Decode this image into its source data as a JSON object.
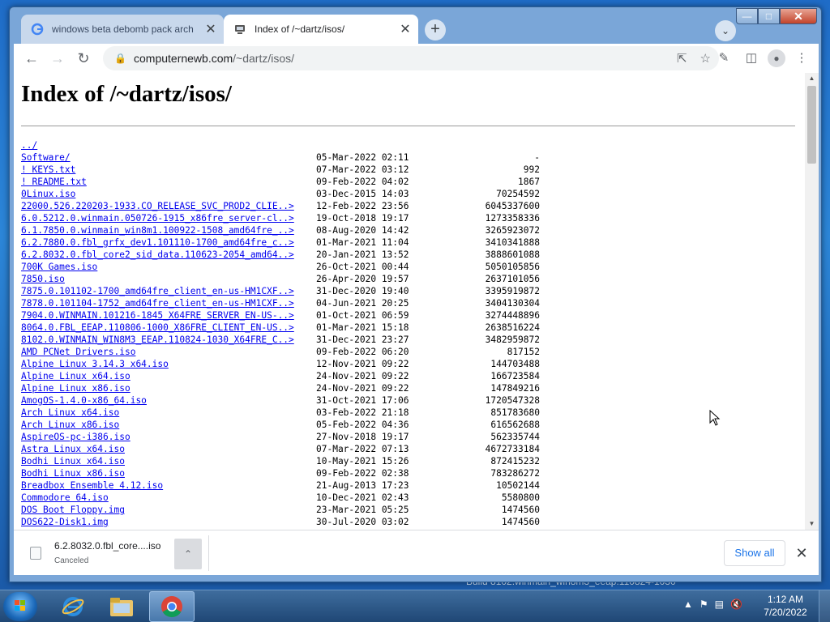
{
  "browser": {
    "tabs": [
      {
        "title": "windows beta debomb pack arch",
        "active": false
      },
      {
        "title": "Index of /~dartz/isos/",
        "active": true
      }
    ],
    "url_host": "computernewb.com",
    "url_path": "/~dartz/isos/"
  },
  "page": {
    "title": "Index of /~dartz/isos/",
    "entries": [
      {
        "name": "../",
        "date": "",
        "size": ""
      },
      {
        "name": "Software/",
        "date": "05-Mar-2022 02:11",
        "size": "-"
      },
      {
        "name": "! KEYS.txt",
        "date": "07-Mar-2022 03:12",
        "size": "992"
      },
      {
        "name": "! README.txt",
        "date": "09-Feb-2022 04:02",
        "size": "1867"
      },
      {
        "name": "0Linux.iso",
        "date": "03-Dec-2015 14:03",
        "size": "70254592"
      },
      {
        "name": "22000.526.220203-1933.CO_RELEASE_SVC_PROD2_CLIE..>",
        "date": "12-Feb-2022 23:56",
        "size": "6045337600"
      },
      {
        "name": "6.0.5212.0.winmain.050726-1915_x86fre_server-cl..>",
        "date": "19-Oct-2018 19:17",
        "size": "1273358336"
      },
      {
        "name": "6.1.7850.0.winmain_win8m1.100922-1508_amd64fre_..>",
        "date": "08-Aug-2020 14:42",
        "size": "3265923072"
      },
      {
        "name": "6.2.7880.0.fbl_grfx_dev1.101110-1700_amd64fre_c..>",
        "date": "01-Mar-2021 11:04",
        "size": "3410341888"
      },
      {
        "name": "6.2.8032.0.fbl_core2_sid_data.110623-2054_amd64..>",
        "date": "20-Jan-2021 13:52",
        "size": "3888601088"
      },
      {
        "name": "700K Games.iso",
        "date": "26-Oct-2021 00:44",
        "size": "5050105856"
      },
      {
        "name": "7850.iso",
        "date": "26-Apr-2020 19:57",
        "size": "2637101056"
      },
      {
        "name": "7875.0.101102-1700_amd64fre_client_en-us-HM1CXF..>",
        "date": "31-Dec-2020 19:40",
        "size": "3395919872"
      },
      {
        "name": "7878.0.101104-1752_amd64fre_client_en-us-HM1CXF..>",
        "date": "04-Jun-2021 20:25",
        "size": "3404130304"
      },
      {
        "name": "7904.0.WINMAIN.101216-1845_X64FRE_SERVER_EN-US-..>",
        "date": "01-Oct-2021 06:59",
        "size": "3274448896"
      },
      {
        "name": "8064.0.FBL_EEAP.110806-1000_X86FRE_CLIENT_EN-US..>",
        "date": "01-Mar-2021 15:18",
        "size": "2638516224"
      },
      {
        "name": "8102.0.WINMAIN_WIN8M3_EEAP.110824-1030_X64FRE_C..>",
        "date": "31-Dec-2021 23:27",
        "size": "3482959872"
      },
      {
        "name": "AMD PCNet Drivers.iso",
        "date": "09-Feb-2022 06:20",
        "size": "817152"
      },
      {
        "name": "Alpine Linux 3.14.3 x64.iso",
        "date": "12-Nov-2021 09:22",
        "size": "144703488"
      },
      {
        "name": "Alpine Linux x64.iso",
        "date": "24-Nov-2021 09:22",
        "size": "166723584"
      },
      {
        "name": "Alpine Linux x86.iso",
        "date": "24-Nov-2021 09:22",
        "size": "147849216"
      },
      {
        "name": "AmogOS-1.4.0-x86_64.iso",
        "date": "31-Oct-2021 17:06",
        "size": "1720547328"
      },
      {
        "name": "Arch Linux x64.iso",
        "date": "03-Feb-2022 21:18",
        "size": "851783680"
      },
      {
        "name": "Arch Linux x86.iso",
        "date": "05-Feb-2022 04:36",
        "size": "616562688"
      },
      {
        "name": "AspireOS-pc-i386.iso",
        "date": "27-Nov-2018 19:17",
        "size": "562335744"
      },
      {
        "name": "Astra Linux x64.iso",
        "date": "07-Mar-2022 07:13",
        "size": "4672733184"
      },
      {
        "name": "Bodhi Linux x64.iso",
        "date": "10-May-2021 15:26",
        "size": "872415232"
      },
      {
        "name": "Bodhi Linux x86.iso",
        "date": "09-Feb-2022 02:38",
        "size": "783286272"
      },
      {
        "name": "Breadbox Ensemble 4.12.iso",
        "date": "21-Aug-2013 17:23",
        "size": "10502144"
      },
      {
        "name": "Commodore 64.iso",
        "date": "10-Dec-2021 02:43",
        "size": "5580800"
      },
      {
        "name": "DOS Boot Floppy.img",
        "date": "23-Mar-2021 05:25",
        "size": "1474560"
      },
      {
        "name": "DOS622-Disk1.img",
        "date": "30-Jul-2020 03:02",
        "size": "1474560"
      }
    ]
  },
  "downloads": {
    "file_name": "6.2.8032.0.fbl_core....iso",
    "status": "Canceled",
    "show_all_label": "Show all"
  },
  "desktop": {
    "background_text": "Build 8102.winmain_win8m3_eeap.110824-1030"
  },
  "taskbar": {
    "time": "1:12 AM",
    "date": "7/20/2022"
  },
  "colors": {
    "link": "#0000ee",
    "accent": "#1a73e8",
    "taskbar": "#1f4775"
  }
}
